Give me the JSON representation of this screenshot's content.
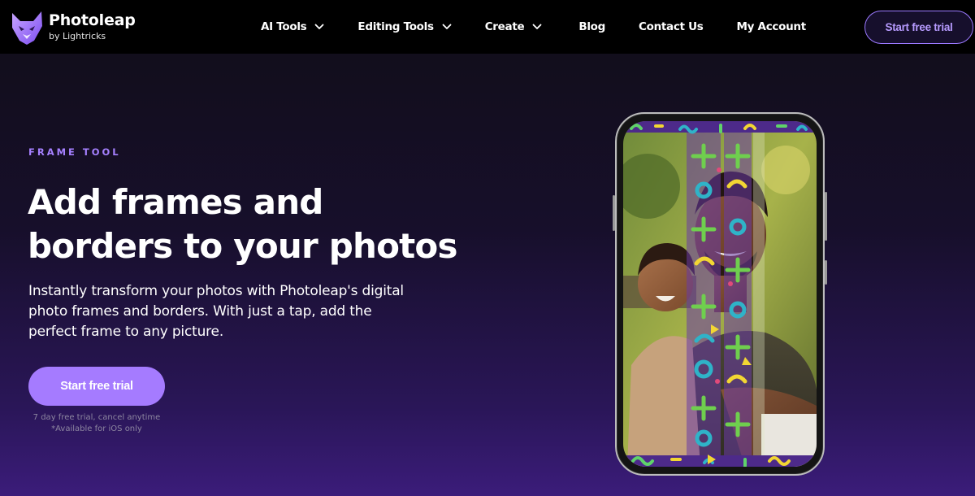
{
  "brand": {
    "name": "Photoleap",
    "sub": "by Lightricks"
  },
  "nav": {
    "items": [
      {
        "label": "AI Tools",
        "has_dropdown": true
      },
      {
        "label": "Editing Tools",
        "has_dropdown": true
      },
      {
        "label": "Create",
        "has_dropdown": true
      },
      {
        "label": "Blog",
        "has_dropdown": false
      },
      {
        "label": "Contact Us",
        "has_dropdown": false
      },
      {
        "label": "My Account",
        "has_dropdown": false
      }
    ],
    "cta_label": "Start free trial"
  },
  "hero": {
    "eyebrow": "FRAME TOOL",
    "headline_line1": "Add frames and",
    "headline_line2": "borders to your photos",
    "subtitle": "Instantly transform your photos with Photoleap's digital photo frames and borders. With just a tap, add the perfect frame to any picture.",
    "cta_label": "Start free trial",
    "fine_print_1": "7 day free trial, cancel anytime",
    "fine_print_2": "*Available for iOS only"
  },
  "colors": {
    "accent": "#a57bff",
    "nav_bg": "#000000",
    "hero_bg_top": "#120e1c",
    "hero_bg_bottom": "#3b1c7a"
  },
  "icons": {
    "logo": "fox-mask-logo",
    "dropdown": "chevron-down-icon"
  }
}
